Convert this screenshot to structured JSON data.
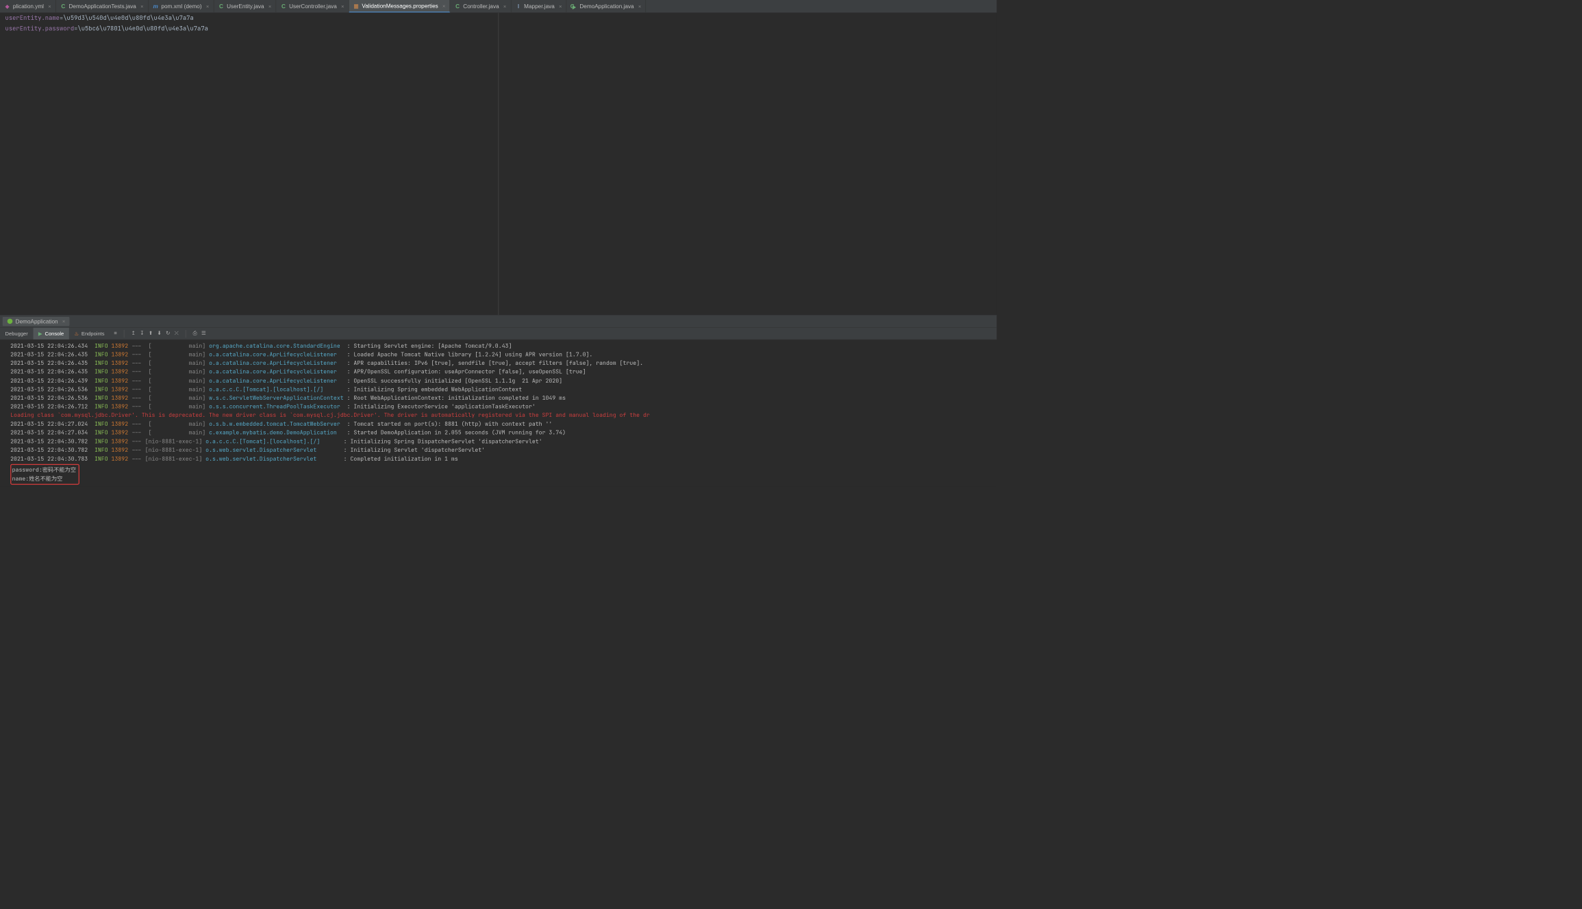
{
  "tabs": [
    {
      "label": "plication.yml",
      "icon": "yml"
    },
    {
      "label": "DemoApplicationTests.java",
      "icon": "class"
    },
    {
      "label": "pom.xml (demo)",
      "icon": "xml"
    },
    {
      "label": "UserEntity.java",
      "icon": "class"
    },
    {
      "label": "UserController.java",
      "icon": "class"
    },
    {
      "label": "ValidationMessages.properties",
      "icon": "prop",
      "active": true
    },
    {
      "label": "Controller.java",
      "icon": "class"
    },
    {
      "label": "Mapper.java",
      "icon": "java"
    },
    {
      "label": "DemoApplication.java",
      "icon": "class-run"
    }
  ],
  "editor_lines": [
    {
      "key": "userEntity.name",
      "value": "\\u59d3\\u540d\\u4e0d\\u80fd\\u4e3a\\u7a7a"
    },
    {
      "key": "userEntity.password",
      "value": "\\u5bc6\\u7801\\u4e0d\\u80fd\\u4e3a\\u7a7a"
    }
  ],
  "run_config_label": "DemoApplication",
  "tool_tabs": {
    "debugger": "Debugger",
    "console": "Console",
    "endpoints": "Endpoints"
  },
  "log_lines": [
    {
      "ts": "2021-03-15 22:04:26.434",
      "lvl": "INFO",
      "pid": "13892",
      "thread": "---  [           main]",
      "logger": "org.apache.catalina.core.StandardEngine ",
      "msg": ": Starting Servlet engine: [Apache Tomcat/9.0.43]"
    },
    {
      "ts": "2021-03-15 22:04:26.435",
      "lvl": "INFO",
      "pid": "13892",
      "thread": "---  [           main]",
      "logger": "o.a.catalina.core.AprLifecycleListener  ",
      "msg": ": Loaded Apache Tomcat Native library [1.2.24] using APR version [1.7.0]."
    },
    {
      "ts": "2021-03-15 22:04:26.435",
      "lvl": "INFO",
      "pid": "13892",
      "thread": "---  [           main]",
      "logger": "o.a.catalina.core.AprLifecycleListener  ",
      "msg": ": APR capabilities: IPv6 [true], sendfile [true], accept filters [false], random [true]."
    },
    {
      "ts": "2021-03-15 22:04:26.435",
      "lvl": "INFO",
      "pid": "13892",
      "thread": "---  [           main]",
      "logger": "o.a.catalina.core.AprLifecycleListener  ",
      "msg": ": APR/OpenSSL configuration: useAprConnector [false], useOpenSSL [true]"
    },
    {
      "ts": "2021-03-15 22:04:26.439",
      "lvl": "INFO",
      "pid": "13892",
      "thread": "---  [           main]",
      "logger": "o.a.catalina.core.AprLifecycleListener  ",
      "msg": ": OpenSSL successfully initialized [OpenSSL 1.1.1g  21 Apr 2020]"
    },
    {
      "ts": "2021-03-15 22:04:26.536",
      "lvl": "INFO",
      "pid": "13892",
      "thread": "---  [           main]",
      "logger": "o.a.c.c.C.[Tomcat].[localhost].[/]      ",
      "msg": ": Initializing Spring embedded WebApplicationContext"
    },
    {
      "ts": "2021-03-15 22:04:26.536",
      "lvl": "INFO",
      "pid": "13892",
      "thread": "---  [           main]",
      "logger": "w.s.c.ServletWebServerApplicationContext",
      "msg": ": Root WebApplicationContext: initialization completed in 1049 ms"
    },
    {
      "ts": "2021-03-15 22:04:26.712",
      "lvl": "INFO",
      "pid": "13892",
      "thread": "---  [           main]",
      "logger": "o.s.s.concurrent.ThreadPoolTaskExecutor ",
      "msg": ": Initializing ExecutorService 'applicationTaskExecutor'"
    }
  ],
  "warn_line": "Loading class `com.mysql.jdbc.Driver'. This is deprecated. The new driver class is `com.mysql.cj.jdbc.Driver'. The driver is automatically registered via the SPI and manual loading of the dr",
  "log_lines_2": [
    {
      "ts": "2021-03-15 22:04:27.024",
      "lvl": "INFO",
      "pid": "13892",
      "thread": "---  [           main]",
      "logger": "o.s.b.w.embedded.tomcat.TomcatWebServer ",
      "msg": ": Tomcat started on port(s): 8881 (http) with context path ''"
    },
    {
      "ts": "2021-03-15 22:04:27.034",
      "lvl": "INFO",
      "pid": "13892",
      "thread": "---  [           main]",
      "logger": "c.example.mybatis.demo.DemoApplication  ",
      "msg": ": Started DemoApplication in 2.055 seconds (JVM running for 3.74)"
    },
    {
      "ts": "2021-03-15 22:04:30.782",
      "lvl": "INFO",
      "pid": "13892",
      "thread": "--- [nio-8881-exec-1]",
      "logger": "o.a.c.c.C.[Tomcat].[localhost].[/]      ",
      "msg": ": Initializing Spring DispatcherServlet 'dispatcherServlet'"
    },
    {
      "ts": "2021-03-15 22:04:30.782",
      "lvl": "INFO",
      "pid": "13892",
      "thread": "--- [nio-8881-exec-1]",
      "logger": "o.s.web.servlet.DispatcherServlet       ",
      "msg": ": Initializing Servlet 'dispatcherServlet'"
    },
    {
      "ts": "2021-03-15 22:04:30.783",
      "lvl": "INFO",
      "pid": "13892",
      "thread": "--- [nio-8881-exec-1]",
      "logger": "o.s.web.servlet.DispatcherServlet       ",
      "msg": ": Completed initialization in 1 ms"
    }
  ],
  "highlight": {
    "line1": "password:密码不能为空",
    "line2": "name:姓名不能为空"
  }
}
